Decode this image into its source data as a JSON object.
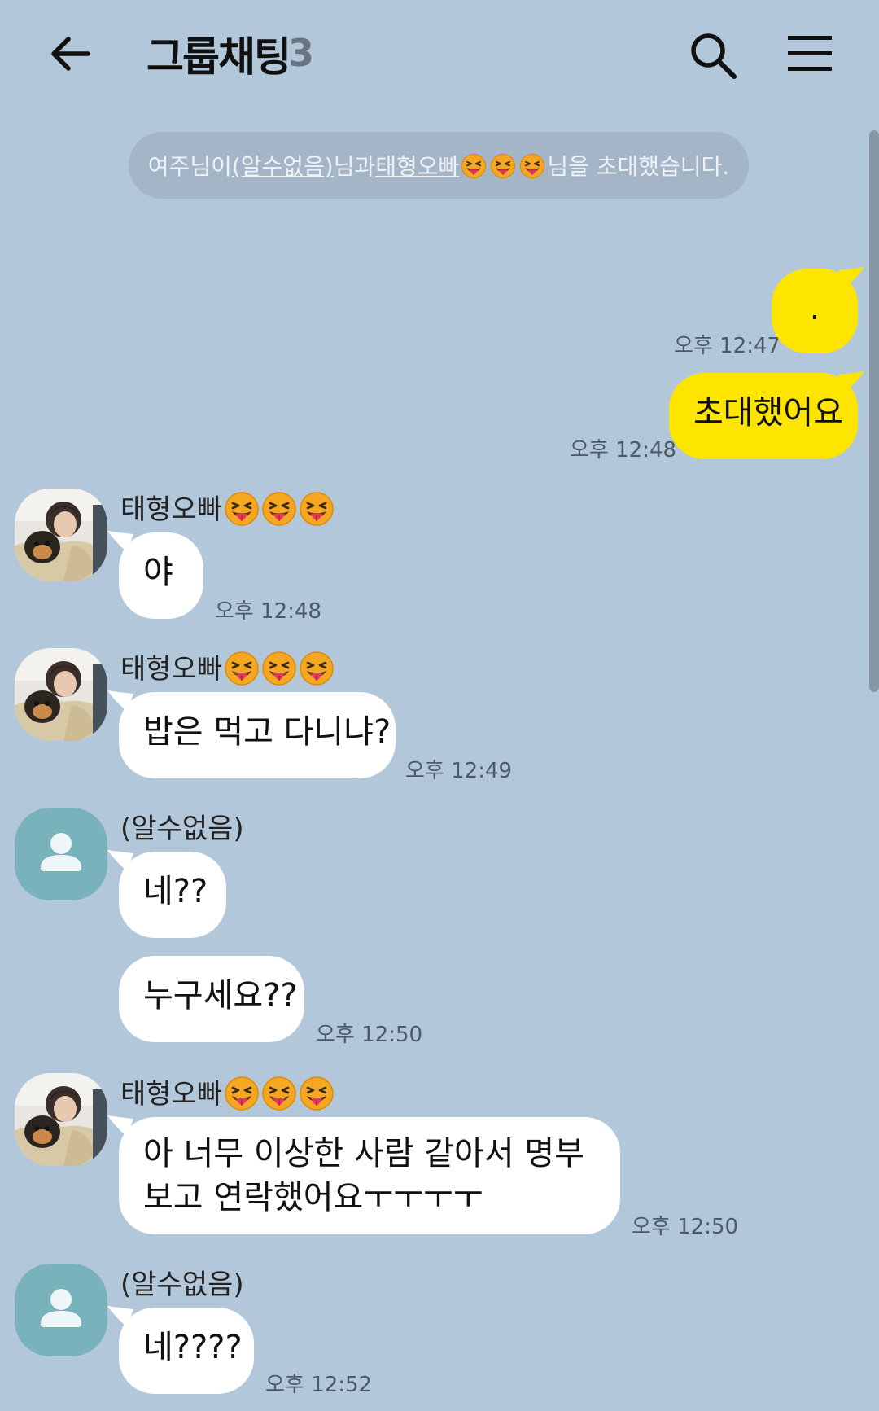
{
  "header": {
    "title": "그룹채팅",
    "member_count": "3",
    "back_icon": "arrow-left-icon",
    "search_icon": "search-icon",
    "menu_icon": "hamburger-menu-icon"
  },
  "notice": {
    "prefix": "여주님이 ",
    "invitee1": "(알수없음)",
    "mid": "님과 ",
    "invitee2": "태형오빠",
    "suffix": "님을 초대했습니다."
  },
  "users": {
    "taehyung": "태형오빠",
    "unknown": "(알수없음)"
  },
  "messages": [
    {
      "text": ".",
      "time": "오후 12:47"
    },
    {
      "text": "초대했어요",
      "time": "오후 12:48"
    },
    {
      "text": "야",
      "time": "오후 12:48"
    },
    {
      "text": "밥은 먹고 다니냐?",
      "time": "오후 12:49"
    },
    {
      "text": "네??",
      "time": ""
    },
    {
      "text": "누구세요??",
      "time": "오후 12:50"
    },
    {
      "line1": "아 너무 이상한 사람 같아서 명부",
      "line2": "보고 연락했어요ㅜㅜㅜㅜ",
      "time": "오후 12:50"
    },
    {
      "text": "네????",
      "time": "오후 12:52"
    }
  ],
  "colors": {
    "background": "#b2c7da",
    "my_bubble": "#fee500",
    "other_bubble": "#ffffff",
    "default_avatar": "#79b2ba"
  }
}
